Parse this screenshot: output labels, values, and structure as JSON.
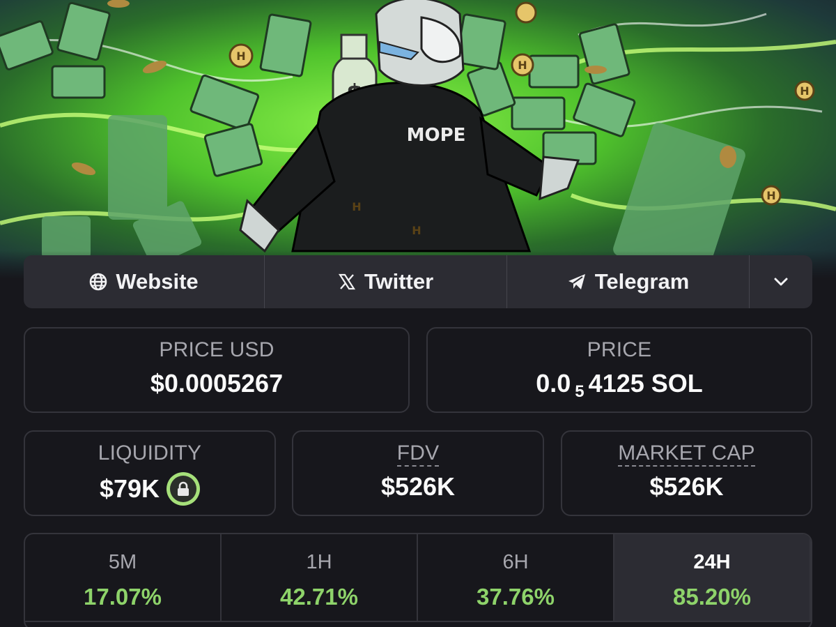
{
  "links": {
    "website_label": "Website",
    "twitter_label": "Twitter",
    "telegram_label": "Telegram"
  },
  "price_usd": {
    "label": "PRICE USD",
    "value": "$0.0005267"
  },
  "price_sol": {
    "label": "PRICE",
    "value_prefix": "0.0",
    "value_subscript": "5",
    "value_suffix": "4125 SOL"
  },
  "liquidity": {
    "label": "LIQUIDITY",
    "value": "$79K"
  },
  "fdv": {
    "label": "FDV",
    "value": "$526K"
  },
  "market_cap": {
    "label": "MARKET CAP",
    "value": "$526K"
  },
  "timeframes": [
    {
      "label": "5M",
      "change": "17.07%"
    },
    {
      "label": "1H",
      "change": "42.71%"
    },
    {
      "label": "6H",
      "change": "37.76%"
    },
    {
      "label": "24H",
      "change": "85.20%",
      "selected": true
    }
  ],
  "banner": {
    "shirt_text": "MOPE",
    "coin_letter": "H"
  },
  "colors": {
    "positive": "#8ed36a",
    "lock_ring": "#a6e07a",
    "banner_green": "#4fc22c"
  }
}
